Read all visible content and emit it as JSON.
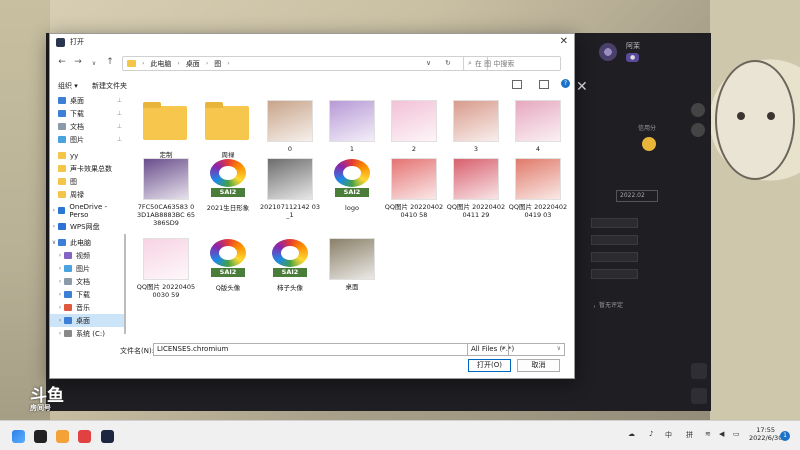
{
  "dialog": {
    "title": "打开",
    "breadcrumbs": [
      "此电脑",
      "桌面",
      "图"
    ],
    "search_placeholder": "在 图 中搜索",
    "organize": "组织",
    "new_folder": "新建文件夹"
  },
  "nav": [
    {
      "label": "桌面",
      "color": "#3d7fd6",
      "pinned": true
    },
    {
      "label": "下载",
      "color": "#3d7fd6",
      "pinned": true
    },
    {
      "label": "文档",
      "color": "#8a9aa8",
      "pinned": true
    },
    {
      "label": "图片",
      "color": "#4aa3df",
      "pinned": true
    },
    {
      "label": "yy",
      "color": "#f3c64a",
      "pinned": false
    },
    {
      "label": "声卡效果总数",
      "color": "#f3c64a",
      "pinned": false
    },
    {
      "label": "图",
      "color": "#f3c64a",
      "pinned": false
    },
    {
      "label": "周禄",
      "color": "#f3c64a",
      "pinned": false
    },
    {
      "label": "OneDrive - Perso",
      "color": "#2b78d4",
      "pinned": false
    },
    {
      "label": "WPS网盘",
      "color": "#2e6fd8",
      "pinned": false
    },
    {
      "label": "此电脑",
      "color": "#3d7fd6",
      "pinned": false
    },
    {
      "label": "视频",
      "color": "#8464c4",
      "pinned": false
    },
    {
      "label": "图片",
      "color": "#4aa3df",
      "pinned": false
    },
    {
      "label": "文档",
      "color": "#8a9aa8",
      "pinned": false
    },
    {
      "label": "下载",
      "color": "#3d7fd6",
      "pinned": false
    },
    {
      "label": "音乐",
      "color": "#e0583d",
      "pinned": false
    },
    {
      "label": "桌面",
      "color": "#3d7fd6",
      "pinned": false,
      "selected": true
    },
    {
      "label": "系统 (C:)",
      "color": "#888888",
      "pinned": false
    }
  ],
  "files": [
    {
      "label": "定制",
      "kind": "folder"
    },
    {
      "label": "周禄",
      "kind": "folder"
    },
    {
      "label": "0",
      "kind": "image",
      "color": "#c8a48a"
    },
    {
      "label": "1",
      "kind": "image",
      "color": "#b79ad6"
    },
    {
      "label": "2",
      "kind": "image",
      "color": "#f2c1d6"
    },
    {
      "label": "3",
      "kind": "image",
      "color": "#d89b8c"
    },
    {
      "label": "4",
      "kind": "image",
      "color": "#e6a8bf"
    },
    {
      "label": "7FC50CA63583 03D1AB8883BC 65386SD9",
      "kind": "image",
      "color": "#6a4e8c"
    },
    {
      "label": "2021生日形象",
      "kind": "sai"
    },
    {
      "label": "202107112142 03_1",
      "kind": "image",
      "color": "#6d6d6d"
    },
    {
      "label": "logo",
      "kind": "sai"
    },
    {
      "label": "QQ图片 202204020410 58",
      "kind": "image",
      "color": "#e57373"
    },
    {
      "label": "QQ图片 202204020411 29",
      "kind": "image",
      "color": "#d8606e"
    },
    {
      "label": "QQ图片 202204020419 03",
      "kind": "image",
      "color": "#e07a6a"
    },
    {
      "label": "QQ图片 202204050030 59",
      "kind": "image",
      "color": "#f7d3e3"
    },
    {
      "label": "Q版头像",
      "kind": "sai"
    },
    {
      "label": "柿子头像",
      "kind": "sai"
    },
    {
      "label": "桌面",
      "kind": "image",
      "color": "#8a7f68"
    }
  ],
  "sai_text": "SAI2",
  "bottom": {
    "filename_label": "文件名(N):",
    "filename_value": "LICENSES.chromium",
    "filetype": "All Files (*.*)",
    "open_button": "打开(O)",
    "cancel_button": "取消"
  },
  "background_app": {
    "username": "阿茉",
    "credit": "信用分",
    "date_dropdown": "2022.02",
    "tip": "，暂无评定"
  },
  "taskbar": {
    "tray": [
      "中",
      "拼"
    ],
    "time": "17:55",
    "date": "2022/6/30",
    "notifications": "1"
  },
  "watermark": {
    "main": "斗鱼",
    "sub": "房间号"
  }
}
